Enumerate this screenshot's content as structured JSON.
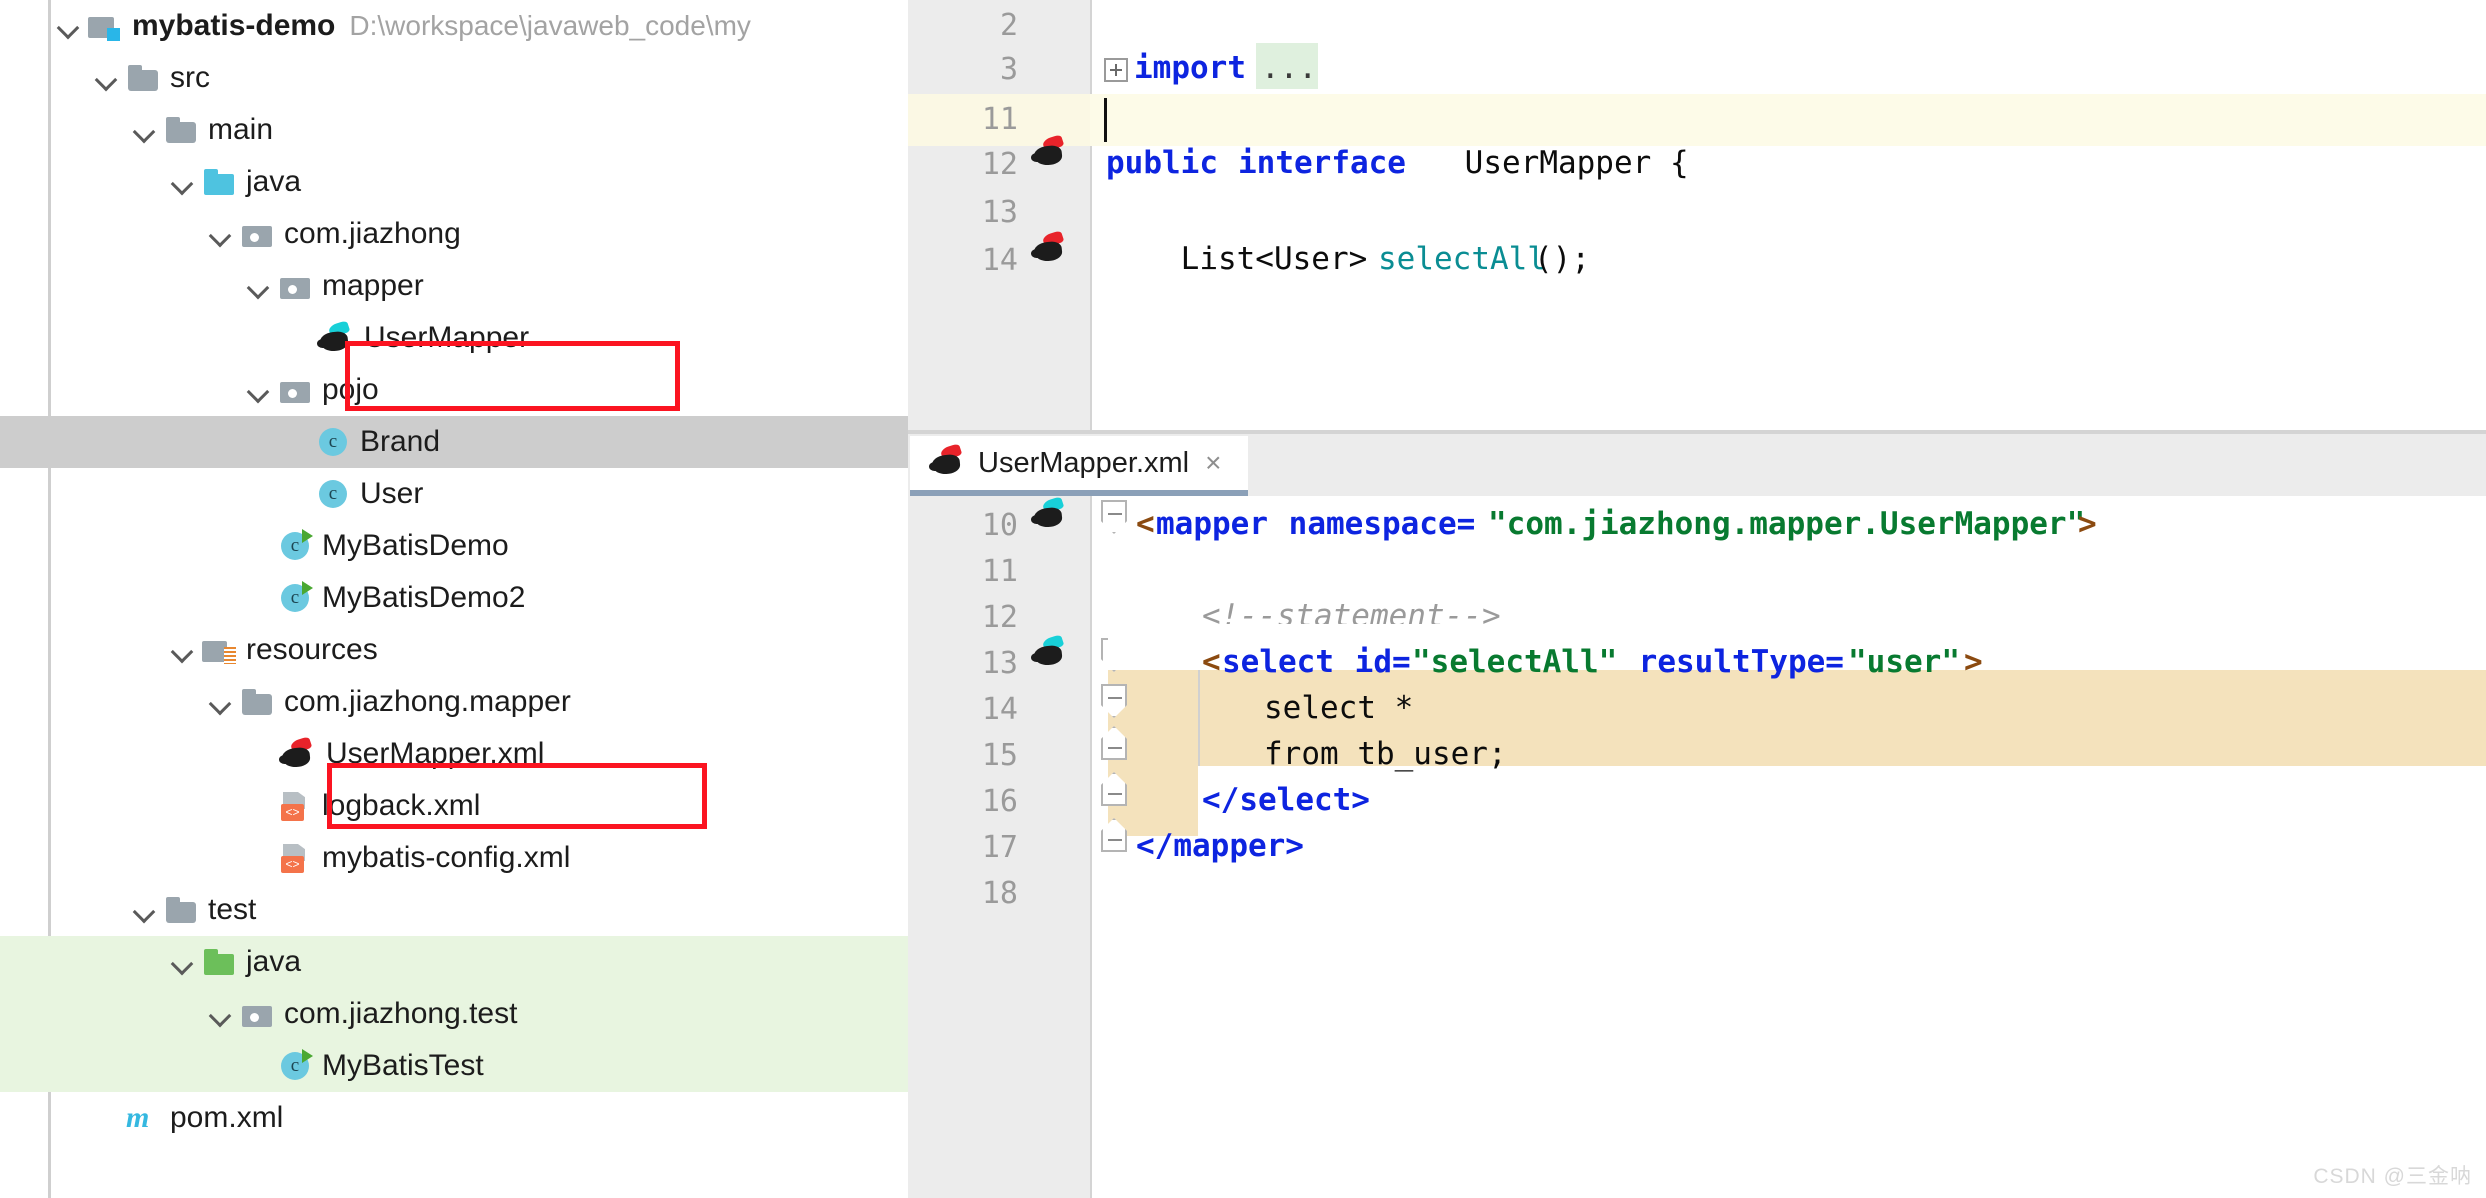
{
  "project_tree": {
    "rows": [
      {
        "indent": 0,
        "twisty": "open",
        "icon": "module-folder-icon",
        "label": "mybatis-demo",
        "bold": true,
        "path": "D:\\workspace\\javaweb_code\\my",
        "selection": "none"
      },
      {
        "indent": 1,
        "twisty": "open",
        "icon": "folder-icon",
        "label": "src",
        "bold": false,
        "path": "",
        "selection": "none"
      },
      {
        "indent": 2,
        "twisty": "open",
        "icon": "folder-icon",
        "label": "main",
        "bold": false,
        "path": "",
        "selection": "none"
      },
      {
        "indent": 3,
        "twisty": "open",
        "icon": "source-folder-icon",
        "label": "java",
        "bold": false,
        "path": "",
        "selection": "none"
      },
      {
        "indent": 4,
        "twisty": "open",
        "icon": "package-icon",
        "label": "com.jiazhong",
        "bold": false,
        "path": "",
        "selection": "none"
      },
      {
        "indent": 5,
        "twisty": "open",
        "icon": "package-icon",
        "label": "mapper",
        "bold": false,
        "path": "",
        "selection": "none"
      },
      {
        "indent": 6,
        "twisty": "none",
        "icon": "mybatis-interface-icon",
        "label": "UserMapper",
        "bold": false,
        "path": "",
        "selection": "none"
      },
      {
        "indent": 5,
        "twisty": "open",
        "icon": "package-icon",
        "label": "pojo",
        "bold": false,
        "path": "",
        "selection": "none"
      },
      {
        "indent": 6,
        "twisty": "none",
        "icon": "java-class-icon",
        "label": "Brand",
        "bold": false,
        "path": "",
        "selection": "gray"
      },
      {
        "indent": 6,
        "twisty": "none",
        "icon": "java-class-icon",
        "label": "User",
        "bold": false,
        "path": "",
        "selection": "none"
      },
      {
        "indent": 5,
        "twisty": "none",
        "icon": "java-runnable-class-icon",
        "label": "MyBatisDemo",
        "bold": false,
        "path": "",
        "selection": "none"
      },
      {
        "indent": 5,
        "twisty": "none",
        "icon": "java-runnable-class-icon",
        "label": "MyBatisDemo2",
        "bold": false,
        "path": "",
        "selection": "none"
      },
      {
        "indent": 3,
        "twisty": "open",
        "icon": "resources-folder-icon",
        "label": "resources",
        "bold": false,
        "path": "",
        "selection": "none"
      },
      {
        "indent": 4,
        "twisty": "open",
        "icon": "folder-icon",
        "label": "com.jiazhong.mapper",
        "bold": false,
        "path": "",
        "selection": "none"
      },
      {
        "indent": 5,
        "twisty": "none",
        "icon": "mybatis-xml-icon",
        "label": "UserMapper.xml",
        "bold": false,
        "path": "",
        "selection": "none"
      },
      {
        "indent": 5,
        "twisty": "none",
        "icon": "xml-file-icon",
        "label": "logback.xml",
        "bold": false,
        "path": "",
        "selection": "none"
      },
      {
        "indent": 5,
        "twisty": "none",
        "icon": "xml-file-icon",
        "label": "mybatis-config.xml",
        "bold": false,
        "path": "",
        "selection": "none"
      },
      {
        "indent": 2,
        "twisty": "open",
        "icon": "folder-icon",
        "label": "test",
        "bold": false,
        "path": "",
        "selection": "none"
      },
      {
        "indent": 3,
        "twisty": "open",
        "icon": "test-source-folder-icon",
        "label": "java",
        "bold": false,
        "path": "",
        "selection": "green"
      },
      {
        "indent": 4,
        "twisty": "open",
        "icon": "package-icon",
        "label": "com.jiazhong.test",
        "bold": false,
        "path": "",
        "selection": "green"
      },
      {
        "indent": 5,
        "twisty": "none",
        "icon": "java-runnable-class-icon",
        "label": "MyBatisTest",
        "bold": false,
        "path": "",
        "selection": "green"
      },
      {
        "indent": 1,
        "twisty": "none",
        "icon": "maven-pom-icon",
        "label": "pom.xml",
        "bold": false,
        "path": "",
        "selection": "none"
      }
    ],
    "annotations": [
      {
        "name": "redbox-usermapper",
        "target": "UserMapper",
        "color": "#fb1421"
      },
      {
        "name": "redbox-usermapperxml",
        "target": "UserMapper.xml",
        "color": "#fb1421"
      }
    ]
  },
  "java_editor": {
    "lines": [
      {
        "num": "2",
        "text": "",
        "gutter_icon": "none"
      },
      {
        "num": "3",
        "text": "import ...",
        "gutter_icon": "none"
      },
      {
        "num": "11",
        "text": "",
        "gutter_icon": "none"
      },
      {
        "num": "12",
        "text": "public interface UserMapper {",
        "gutter_icon": "mybatis-bird-icon"
      },
      {
        "num": "13",
        "text": "",
        "gutter_icon": "none"
      },
      {
        "num": "14",
        "text": "    List<User> selectAll();",
        "gutter_icon": "mybatis-bird-icon"
      }
    ],
    "current_line": "11",
    "folded_marker": "...",
    "tokens": {
      "import_kw": "import",
      "ellipsis": "...",
      "public_kw": "public",
      "interface_kw": "interface",
      "usermapper": " UserMapper {",
      "list_user": "    List<User> ",
      "selectall": "selectAll",
      "parens": "();"
    }
  },
  "tabs": {
    "active": {
      "label": "UserMapper.xml",
      "close": "×",
      "icon": "mybatis-xml-icon"
    }
  },
  "xml_editor": {
    "lines": [
      {
        "num": "10",
        "gutter_icon": "mybatis-bird-icon",
        "fold": "top"
      },
      {
        "num": "11",
        "gutter_icon": "none",
        "fold": "none"
      },
      {
        "num": "12",
        "gutter_icon": "none",
        "fold": "none"
      },
      {
        "num": "13",
        "gutter_icon": "mybatis-bird-icon",
        "fold": "top"
      },
      {
        "num": "14",
        "gutter_icon": "none",
        "fold": "top"
      },
      {
        "num": "15",
        "gutter_icon": "none",
        "fold": "bottom"
      },
      {
        "num": "16",
        "gutter_icon": "none",
        "fold": "bottom"
      },
      {
        "num": "17",
        "gutter_icon": "none",
        "fold": "bottom"
      },
      {
        "num": "18",
        "gutter_icon": "none",
        "fold": "none"
      }
    ],
    "tokens": {
      "mapper_open_lt": "<",
      "mapper_tag": "mapper",
      "ns_attr": " namespace=",
      "ns_val": "\"com.jiazhong.mapper.UserMapper\"",
      "mapper_gt": ">",
      "comment": "<!--statement-->",
      "select_lt": "<",
      "select_tag": "select",
      "id_attr": " id=",
      "id_val": "\"selectAll\"",
      "rt_attr": " resultType=",
      "rt_val": "\"user\"",
      "select_gt": ">",
      "sql_select": "select *",
      "sql_from": "from tb_user;",
      "select_close": "</select>",
      "mapper_close": "</mapper>"
    }
  },
  "watermark": "CSDN @三金呐",
  "colors": {
    "selection_gray": "#cdcdcd",
    "selection_green": "#e8f5e0",
    "sql_highlight": "#f4e2bc",
    "current_line": "#fdfbe8",
    "annotation_red": "#fb1421",
    "tab_underline": "#8ba0b8",
    "gutter_bg": "#ececec",
    "keyword_blue": "#0d24e0",
    "string_green": "#087a30",
    "method_teal": "#0a8d93"
  }
}
